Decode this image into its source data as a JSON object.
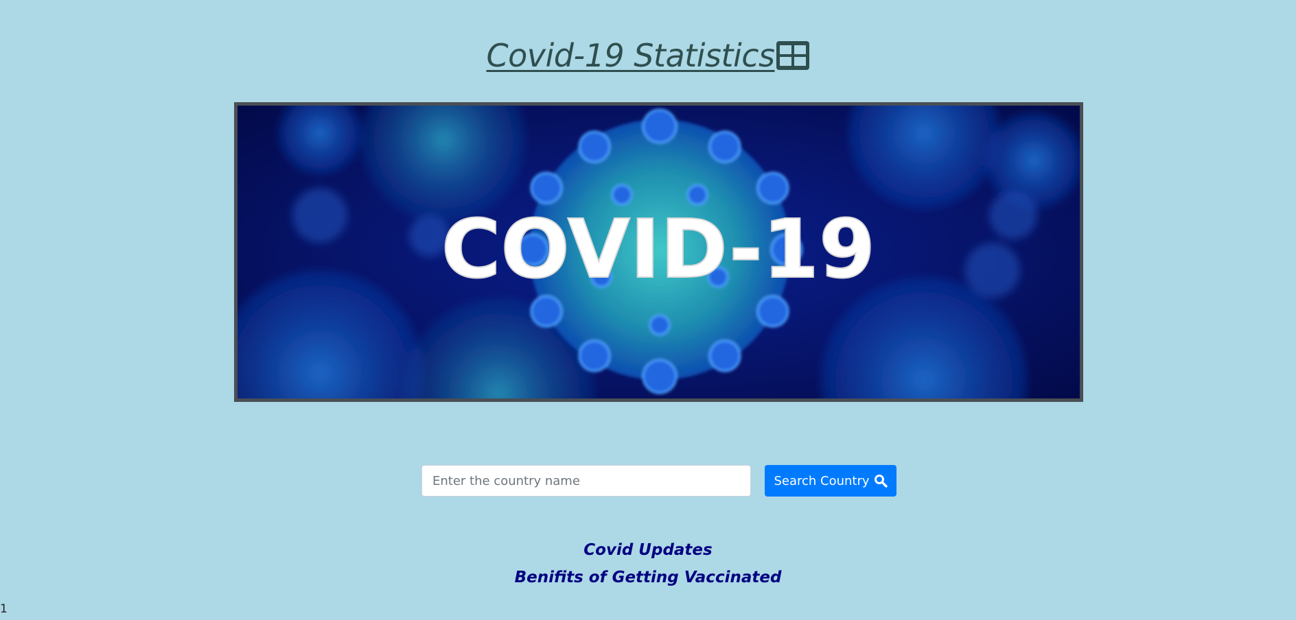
{
  "header": {
    "title": "Covid-19 Statistics",
    "icon": "table-icon"
  },
  "banner": {
    "image_text": "COVID-19",
    "image_description": "blue coronavirus illustration banner"
  },
  "search": {
    "placeholder": "Enter the country name",
    "value": "",
    "button_label": "Search Country",
    "button_icon": "search-icon"
  },
  "links": [
    {
      "label": "Covid Updates"
    },
    {
      "label": "Benifits of Getting Vaccinated"
    }
  ],
  "footer": {
    "page_number": "1"
  },
  "colors": {
    "background": "#add8e6",
    "title": "#2f4f4f",
    "button": "#007bff",
    "links": "#000080"
  }
}
